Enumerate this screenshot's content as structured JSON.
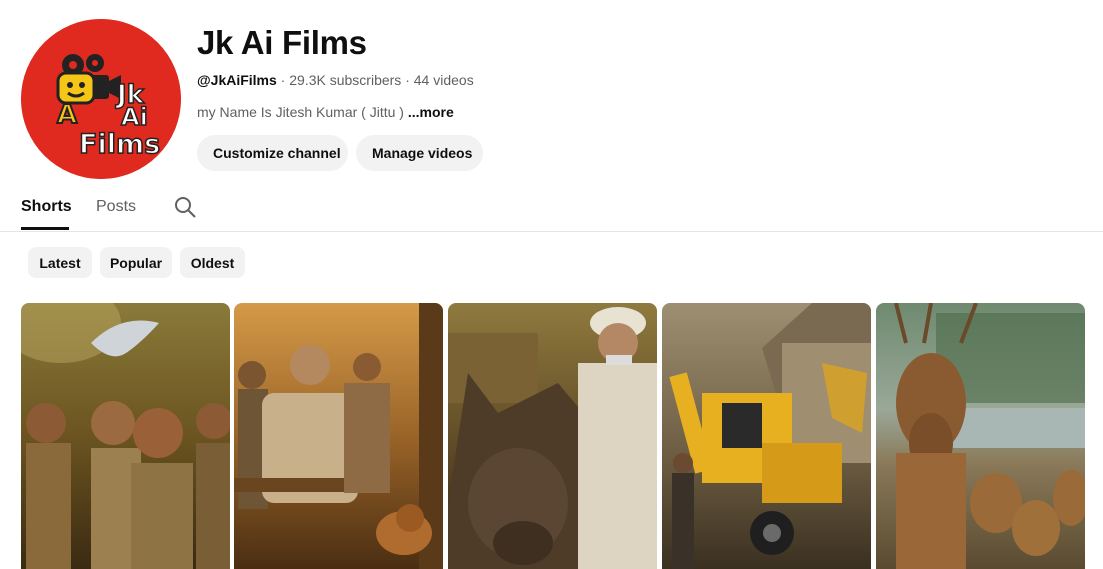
{
  "channel": {
    "name": "Jk Ai Films",
    "handle": "@JkAiFilms",
    "subscribers": "29.3K subscribers",
    "videos": "44 videos",
    "separator": " · ",
    "description": "my Name Is Jitesh Kumar ( Jittu )",
    "more_label": "...more",
    "avatar": {
      "background": "#e02a1f",
      "logo_lines": [
        "Jk",
        "Ai",
        "Films"
      ]
    }
  },
  "actions": {
    "customize_label": "Customize channel",
    "manage_label": "Manage videos"
  },
  "tabs": [
    {
      "label": "Shorts",
      "active": true
    },
    {
      "label": "Posts",
      "active": false
    }
  ],
  "filters": [
    {
      "label": "Latest"
    },
    {
      "label": "Popular"
    },
    {
      "label": "Oldest"
    }
  ],
  "shorts": [
    {
      "scene": "children-running-with-bird"
    },
    {
      "scene": "old-man-sitting-with-dog"
    },
    {
      "scene": "donkey-and-old-man"
    },
    {
      "scene": "jcb-excavator-near-hut"
    },
    {
      "scene": "deer-family-by-river"
    }
  ],
  "icons": {
    "search": "search-icon"
  }
}
